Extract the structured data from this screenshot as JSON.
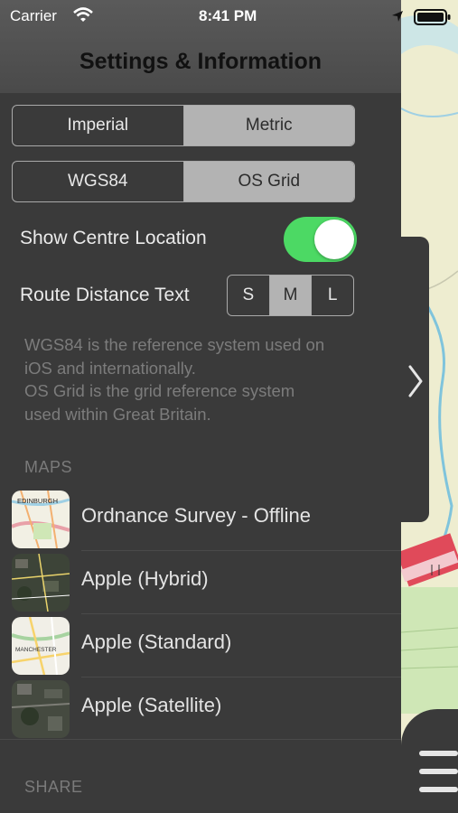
{
  "status_bar": {
    "carrier": "Carrier",
    "time": "8:41 PM"
  },
  "header": {
    "title": "Settings & Information"
  },
  "units": {
    "options": [
      "Imperial",
      "Metric"
    ],
    "selected": "Metric"
  },
  "coordinates": {
    "options": [
      "WGS84",
      "OS Grid"
    ],
    "selected": "OS Grid"
  },
  "show_centre": {
    "label": "Show Centre Location",
    "enabled": true
  },
  "route_text": {
    "label": "Route Distance Text",
    "options": [
      "S",
      "M",
      "L"
    ],
    "selected": "M"
  },
  "info_lines": [
    "WGS84 is the reference system used on",
    "iOS and internationally.",
    "OS Grid is the grid reference system",
    "used within Great Britain."
  ],
  "maps_section": {
    "header": "MAPS",
    "items": [
      {
        "label": "Ordnance Survey - Offline",
        "thumb_text": "EDINBURGH",
        "thumb_icon": "os-map-thumbnail"
      },
      {
        "label": "Apple (Hybrid)",
        "thumb_icon": "hybrid-map-thumbnail"
      },
      {
        "label": "Apple (Standard)",
        "thumb_text": "MANCHESTER",
        "thumb_icon": "standard-map-thumbnail"
      },
      {
        "label": "Apple (Satellite)",
        "thumb_icon": "satellite-map-thumbnail"
      }
    ]
  },
  "share_section": {
    "header": "SHARE"
  },
  "colors": {
    "panel": "#3a3a3a",
    "toggle_on": "#4cd964",
    "selected_segment": "#b3b3b3"
  }
}
